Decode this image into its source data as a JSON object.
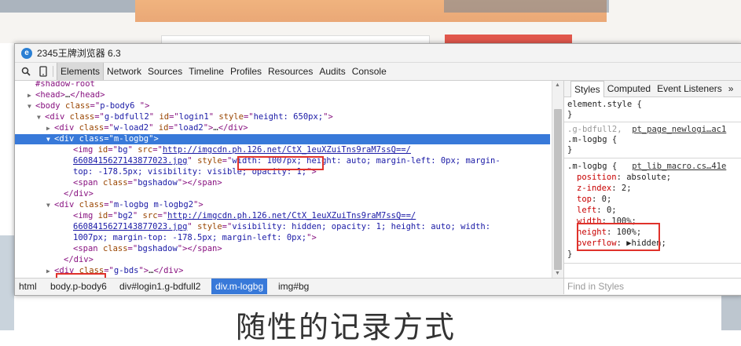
{
  "background": {
    "headline": "随性的记录方式"
  },
  "window": {
    "title": "2345王牌浏览器 6.3",
    "logo_glyph": "e"
  },
  "toolbar": {
    "tabs": [
      "Elements",
      "Network",
      "Sources",
      "Timeline",
      "Profiles",
      "Resources",
      "Audits",
      "Console"
    ],
    "active_tab": "Elements"
  },
  "dom": {
    "lines": [
      {
        "indent": 1,
        "tri": "",
        "parts": [
          [
            "tag",
            "#shadow-root"
          ]
        ]
      },
      {
        "indent": 1,
        "tri": "▶",
        "parts": [
          [
            "tag",
            "<head>"
          ],
          [
            "txt",
            "…"
          ],
          [
            "tag",
            "</head>"
          ]
        ]
      },
      {
        "indent": 1,
        "tri": "▼",
        "parts": [
          [
            "tag",
            "<body "
          ],
          [
            "an",
            "class"
          ],
          [
            "tag",
            "=\""
          ],
          [
            "av",
            "p-body6 "
          ],
          [
            "tag",
            "\">"
          ]
        ]
      },
      {
        "indent": 2,
        "tri": "▼",
        "parts": [
          [
            "tag",
            "<div "
          ],
          [
            "an",
            "class"
          ],
          [
            "tag",
            "=\""
          ],
          [
            "av",
            "g-bdfull2"
          ],
          [
            "tag",
            "\" "
          ],
          [
            "an",
            "id"
          ],
          [
            "tag",
            "=\""
          ],
          [
            "av",
            "login1"
          ],
          [
            "tag",
            "\" "
          ],
          [
            "an",
            "style"
          ],
          [
            "tag",
            "=\""
          ],
          [
            "av",
            "height: 650px;"
          ],
          [
            "tag",
            "\">"
          ]
        ]
      },
      {
        "indent": 3,
        "tri": "▶",
        "parts": [
          [
            "tag",
            "<div "
          ],
          [
            "an",
            "class"
          ],
          [
            "tag",
            "=\""
          ],
          [
            "av",
            "w-load2"
          ],
          [
            "tag",
            "\" "
          ],
          [
            "an",
            "id"
          ],
          [
            "tag",
            "=\""
          ],
          [
            "av",
            "load2"
          ],
          [
            "tag",
            "\">"
          ],
          [
            "txt",
            "…"
          ],
          [
            "tag",
            "</div>"
          ]
        ]
      },
      {
        "indent": 3,
        "tri": "▼",
        "sel": true,
        "parts": [
          [
            "tag",
            "<div "
          ],
          [
            "an",
            "class"
          ],
          [
            "tag",
            "=\""
          ],
          [
            "av",
            "m-logbg"
          ],
          [
            "tag",
            "\">"
          ]
        ]
      },
      {
        "indent": 5,
        "tri": "",
        "parts": [
          [
            "tag",
            "<img "
          ],
          [
            "an",
            "id"
          ],
          [
            "tag",
            "=\""
          ],
          [
            "av",
            "bg"
          ],
          [
            "tag",
            "\" "
          ],
          [
            "an",
            "src"
          ],
          [
            "tag",
            "=\""
          ],
          [
            "lnk",
            "http://imgcdn.ph.126.net/CtX_1euXZuiTns9raM7ssQ==/"
          ]
        ]
      },
      {
        "indent": 5,
        "tri": "",
        "parts": [
          [
            "lnk",
            "6608415627143877023.jpg"
          ],
          [
            "tag",
            "\" "
          ],
          [
            "an",
            "style"
          ],
          [
            "tag",
            "=\""
          ],
          [
            "av",
            "width: 1007px; height: auto; margin-left: 0px; margin-"
          ]
        ]
      },
      {
        "indent": 5,
        "tri": "",
        "parts": [
          [
            "av",
            "top: -178.5px; visibility: visible; opacity: 1;"
          ],
          [
            "tag",
            "\">"
          ]
        ]
      },
      {
        "indent": 5,
        "tri": "",
        "parts": [
          [
            "tag",
            "<span "
          ],
          [
            "an",
            "class"
          ],
          [
            "tag",
            "=\""
          ],
          [
            "av",
            "bgshadow"
          ],
          [
            "tag",
            "\"></span>"
          ]
        ]
      },
      {
        "indent": 4,
        "tri": "",
        "parts": [
          [
            "tag",
            "</div>"
          ]
        ]
      },
      {
        "indent": 3,
        "tri": "▼",
        "parts": [
          [
            "tag",
            "<div "
          ],
          [
            "an",
            "class"
          ],
          [
            "tag",
            "=\""
          ],
          [
            "av",
            "m-logbg m-logbg2"
          ],
          [
            "tag",
            "\">"
          ]
        ]
      },
      {
        "indent": 5,
        "tri": "",
        "parts": [
          [
            "tag",
            "<img "
          ],
          [
            "an",
            "id"
          ],
          [
            "tag",
            "=\""
          ],
          [
            "av",
            "bg2"
          ],
          [
            "tag",
            "\" "
          ],
          [
            "an",
            "src"
          ],
          [
            "tag",
            "=\""
          ],
          [
            "lnk",
            "http://imgcdn.ph.126.net/CtX_1euXZuiTns9raM7ssQ==/"
          ]
        ]
      },
      {
        "indent": 5,
        "tri": "",
        "parts": [
          [
            "lnk",
            "6608415627143877023.jpg"
          ],
          [
            "tag",
            "\" "
          ],
          [
            "an",
            "style"
          ],
          [
            "tag",
            "=\""
          ],
          [
            "av",
            "visibility: hidden; opacity: 1; height: auto; width:"
          ]
        ]
      },
      {
        "indent": 5,
        "tri": "",
        "parts": [
          [
            "av",
            "1007px; margin-top: -178.5px; margin-left: 0px;"
          ],
          [
            "tag",
            "\">"
          ]
        ]
      },
      {
        "indent": 5,
        "tri": "",
        "parts": [
          [
            "tag",
            "<span "
          ],
          [
            "an",
            "class"
          ],
          [
            "tag",
            "=\""
          ],
          [
            "av",
            "bgshadow"
          ],
          [
            "tag",
            "\"></span>"
          ]
        ]
      },
      {
        "indent": 4,
        "tri": "",
        "parts": [
          [
            "tag",
            "</div>"
          ]
        ]
      },
      {
        "indent": 3,
        "tri": "▶",
        "parts": [
          [
            "tag",
            "<div "
          ],
          [
            "an",
            "class"
          ],
          [
            "tag",
            "=\""
          ],
          [
            "av",
            "g-bds"
          ],
          [
            "tag",
            "\">"
          ],
          [
            "txt",
            "…"
          ],
          [
            "tag",
            "</div>"
          ]
        ]
      }
    ]
  },
  "styles": {
    "tabs": [
      "Styles",
      "Computed",
      "Event Listeners"
    ],
    "active_tab": "Styles",
    "more_glyph": "»",
    "element_style": "element.style {",
    "close_brace": "}",
    "rule2_selector1": ".g-bdfull2,",
    "rule2_source": "pt_page_newlogi…ac1",
    "rule2_selector2": ".m-logbg {",
    "rule3_selector": ".m-logbg {",
    "rule3_source": "pt_lib_macro.cs…41e",
    "props": [
      {
        "name": "position",
        "value": "absolute;"
      },
      {
        "name": "z-index",
        "value": "2;"
      },
      {
        "name": "top",
        "value": "0;"
      },
      {
        "name": "left",
        "value": "0;"
      },
      {
        "name": "width",
        "value": "100%;"
      },
      {
        "name": "height",
        "value": "100%;"
      },
      {
        "name": "overflow",
        "value": "▶hidden;"
      }
    ],
    "find_placeholder": "Find in Styles"
  },
  "breadcrumbs": [
    "html",
    "body.p-body6",
    "div#login1.g-bdfull2",
    "div.m-logbg",
    "img#bg"
  ],
  "active_breadcrumb": "div.m-logbg",
  "colors": {
    "selection": "#3879d9",
    "highlight_box": "#e0322b",
    "tag": "#881280",
    "attr_name": "#994500",
    "attr_value": "#1a1aa6",
    "css_prop": "#c80000"
  }
}
